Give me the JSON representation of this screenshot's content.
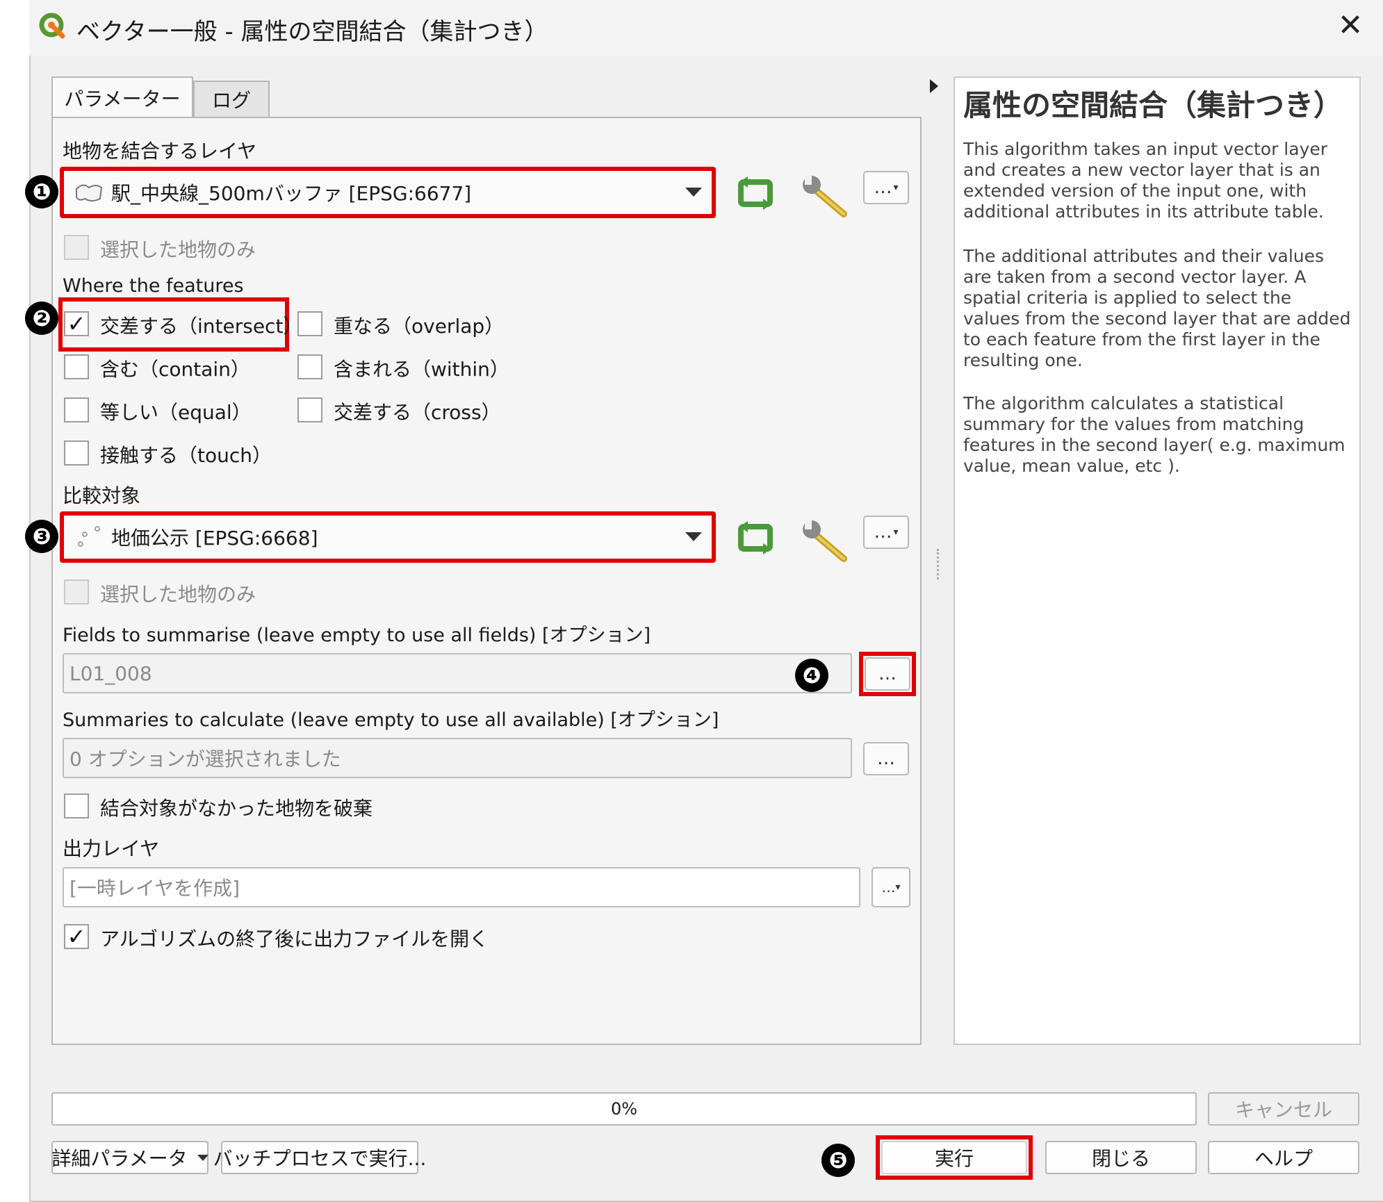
{
  "window": {
    "title": "ベクター一般 - 属性の空間結合（集計つき）",
    "close_icon": "close-icon"
  },
  "tabs": [
    {
      "label": "パラメーター",
      "active": true
    },
    {
      "label": "ログ",
      "active": false
    }
  ],
  "params": {
    "join_layer_label": "地物を結合するレイヤ",
    "join_layer_value": "駅_中央線_500mバッファ [EPSG:6677]",
    "selected_only_label": "選択した地物のみ",
    "where_label": "Where the features",
    "predicates": [
      {
        "label": "交差する（intersect）",
        "checked": true
      },
      {
        "label": "重なる（overlap）",
        "checked": false
      },
      {
        "label": "含む（contain）",
        "checked": false
      },
      {
        "label": "含まれる（within）",
        "checked": false
      },
      {
        "label": "等しい（equal）",
        "checked": false
      },
      {
        "label": "交差する（cross）",
        "checked": false
      },
      {
        "label": "接触する（touch）",
        "checked": false
      }
    ],
    "compare_label": "比較対象",
    "compare_value": "地価公示 [EPSG:6668]",
    "selected_only_label2": "選択した地物のみ",
    "fields_label": "Fields to summarise (leave empty to use all fields) [オプション]",
    "fields_value": "L01_008",
    "summaries_label": "Summaries to calculate (leave empty to use all available) [オプション]",
    "summaries_value": "0 オプションが選択されました",
    "discard_label": "結合対象がなかった地物を破棄",
    "output_label": "出力レイヤ",
    "output_placeholder": "[一時レイヤを作成]",
    "open_output_label": "アルゴリズムの終了後に出力ファイルを開く",
    "ellipsis": "…",
    "ellipsis_small": "…"
  },
  "help": {
    "title": "属性の空間結合（集計つき）",
    "p1": "This algorithm takes an input vector layer and creates a new vector layer that is an extended version of the input one, with additional attributes in its attribute table.",
    "p2": "The additional attributes and their values are taken from a second vector layer. A spatial criteria is applied to select the values from the second layer that are added to each feature from the first layer in the resulting one.",
    "p3": "The algorithm calculates a statistical summary for the values from matching features in the second layer( e.g. maximum value, mean value, etc )."
  },
  "footer": {
    "progress_text": "0%",
    "progress_value": 0,
    "cancel": "キャンセル",
    "advanced": "詳細パラメータ",
    "batch": "バッチプロセスで実行...",
    "run": "実行",
    "close": "閉じる",
    "help": "ヘルプ"
  },
  "annotations": [
    "❶",
    "❷",
    "❸",
    "❹",
    "❺"
  ],
  "colors": {
    "highlight": "#e00000",
    "iterate_icon": "#4a9a3a"
  }
}
